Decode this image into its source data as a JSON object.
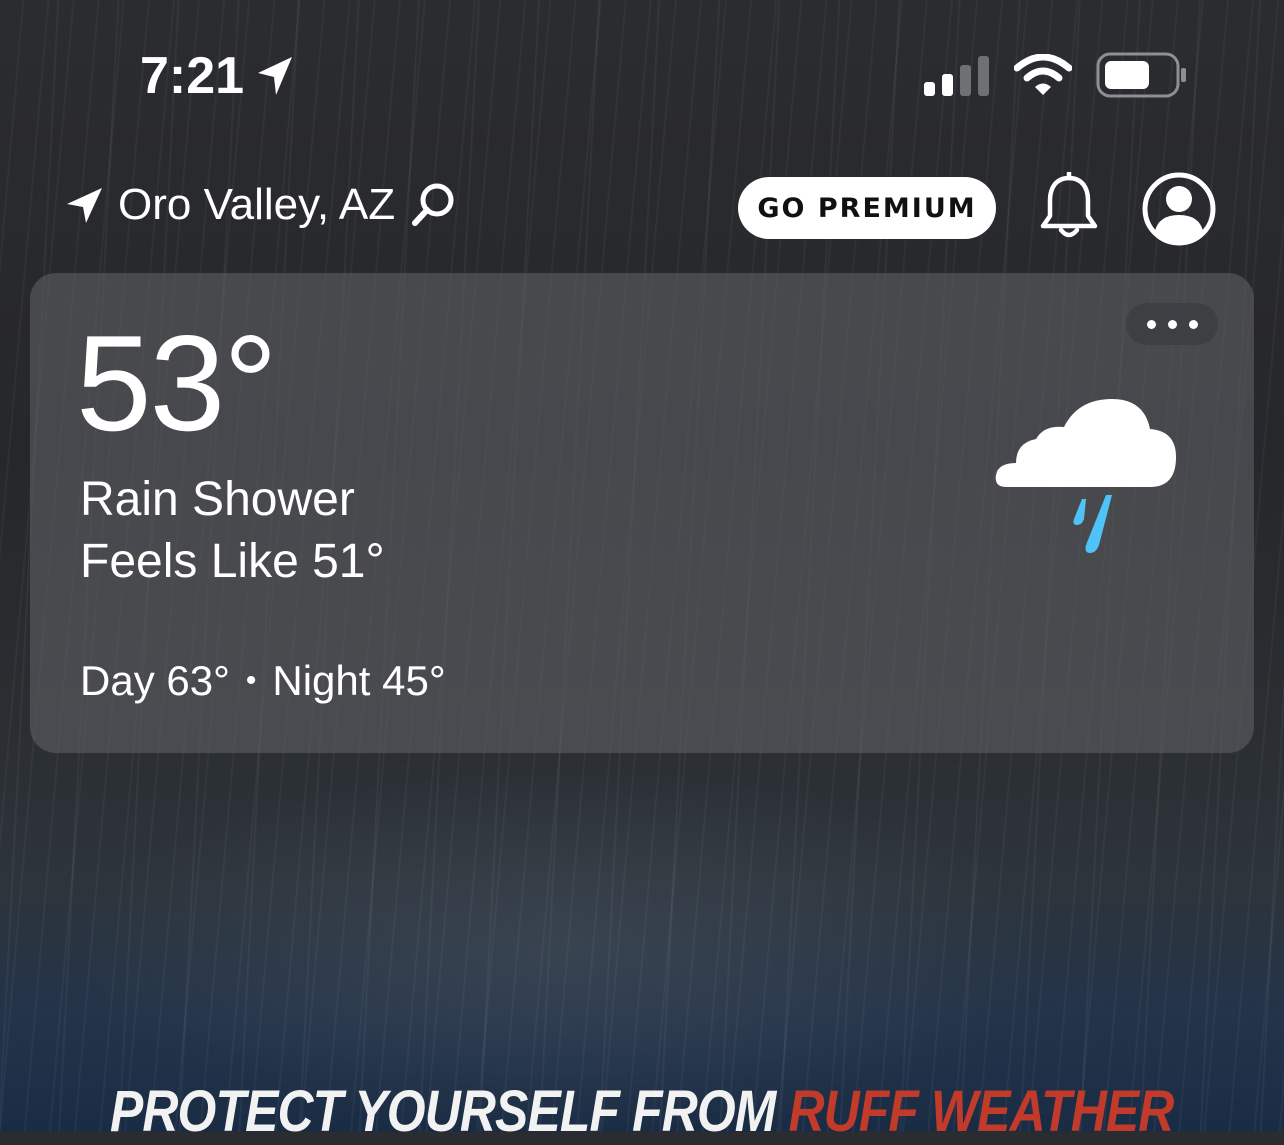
{
  "status_bar": {
    "time": "7:21"
  },
  "header": {
    "location": "Oro Valley, AZ",
    "premium_label": "GO PREMIUM"
  },
  "current": {
    "temperature": "53°",
    "condition": "Rain Shower",
    "feels_like": "Feels Like 51°",
    "day": "Day 63°",
    "separator": "•",
    "night": "Night 45°",
    "icon": "rain-shower-icon"
  },
  "banner": {
    "text_white": "PROTECT YOURSELF FROM ",
    "text_red": "RUFF WEATHER"
  },
  "colors": {
    "rain_drop": "#4fc3f7",
    "banner_red": "#c23a2a"
  }
}
